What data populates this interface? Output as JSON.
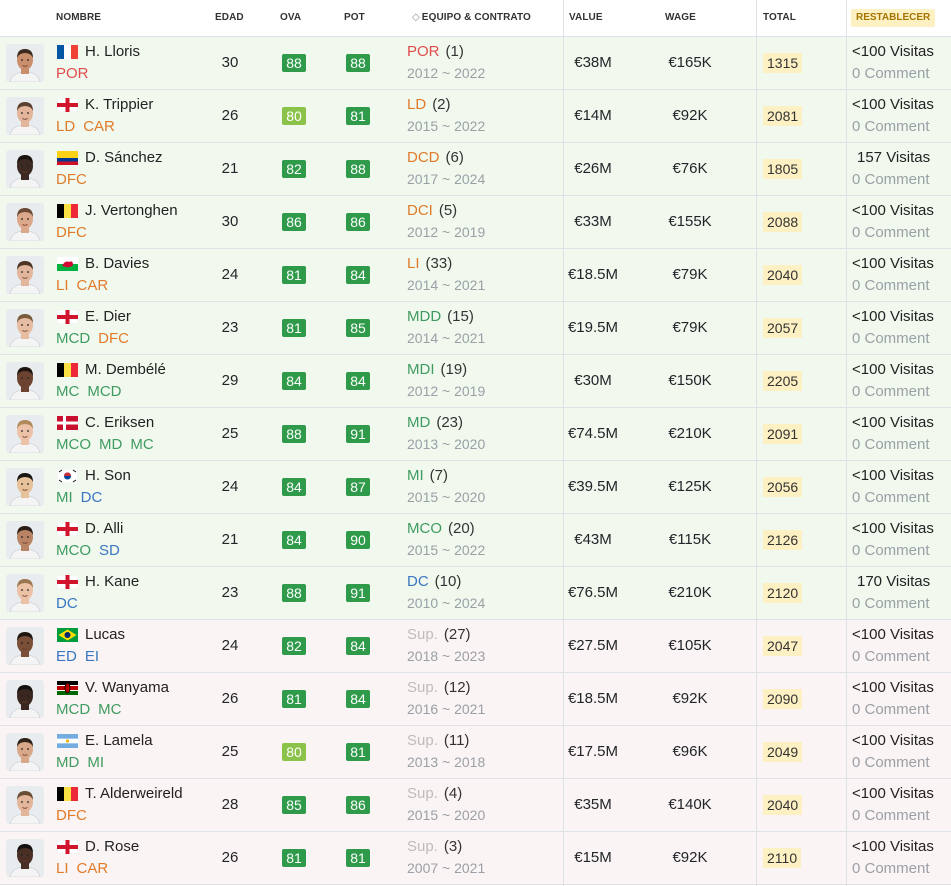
{
  "columns": {
    "name": "NOMBRE",
    "age": "EDAD",
    "ova": "OVA",
    "pot": "POT",
    "team": "EQUIPO & CONTRATO",
    "value": "VALUE",
    "wage": "WAGE",
    "total": "TOTAL",
    "reset": "RESTABLECER"
  },
  "colors": {
    "rating_high": "#2e9a4a",
    "rating_mid": "#8bc34a",
    "pos_forward": "#3a76c2",
    "pos_mid": "#3f9b5f",
    "pos_def": "#e07b2a",
    "pos_gk": "#e14c4c",
    "pos_sub": "#bdbdbd",
    "row_starting": "#f1f9ef",
    "row_sub": "#fbf4f4",
    "total_bg": "#fdf0c2"
  },
  "players": [
    {
      "name": "H. Lloris",
      "country": "France",
      "positions": [
        {
          "label": "POR",
          "kind": "gk"
        }
      ],
      "age": "30",
      "ova": "88",
      "ova_level": "high",
      "pot": "88",
      "pot_level": "high",
      "team_pos": "POR",
      "team_pos_kind": "gk",
      "number": "(1)",
      "contract": "2012 ~ 2022",
      "value": "€38M",
      "wage": "€165K",
      "total": "1315",
      "visits": "<100 Visitas",
      "comments": "0 Comment",
      "row": "starting",
      "skin": "#c98e6b",
      "hair": "#3a2a1f"
    },
    {
      "name": "K. Trippier",
      "country": "England",
      "positions": [
        {
          "label": "LD",
          "kind": "def"
        },
        {
          "label": "CAR",
          "kind": "def"
        }
      ],
      "age": "26",
      "ova": "80",
      "ova_level": "mid",
      "pot": "81",
      "pot_level": "high",
      "team_pos": "LD",
      "team_pos_kind": "def",
      "number": "(2)",
      "contract": "2015 ~ 2022",
      "value": "€14M",
      "wage": "€92K",
      "total": "2081",
      "visits": "<100 Visitas",
      "comments": "0 Comment",
      "row": "starting",
      "skin": "#e3b59a",
      "hair": "#5a4030"
    },
    {
      "name": "D. Sánchez",
      "country": "Colombia",
      "positions": [
        {
          "label": "DFC",
          "kind": "def"
        }
      ],
      "age": "21",
      "ova": "82",
      "ova_level": "high",
      "pot": "88",
      "pot_level": "high",
      "team_pos": "DCD",
      "team_pos_kind": "def",
      "number": "(6)",
      "contract": "2017 ~ 2024",
      "value": "€26M",
      "wage": "€76K",
      "total": "1805",
      "visits": "157 Visitas",
      "comments": "0 Comment",
      "row": "starting",
      "skin": "#3c2a22",
      "hair": "#1a1410"
    },
    {
      "name": "J. Vertonghen",
      "country": "Belgium",
      "positions": [
        {
          "label": "DFC",
          "kind": "def"
        }
      ],
      "age": "30",
      "ova": "86",
      "ova_level": "high",
      "pot": "86",
      "pot_level": "high",
      "team_pos": "DCI",
      "team_pos_kind": "def",
      "number": "(5)",
      "contract": "2012 ~ 2019",
      "value": "€33M",
      "wage": "€155K",
      "total": "2088",
      "visits": "<100 Visitas",
      "comments": "0 Comment",
      "row": "starting",
      "skin": "#dca88c",
      "hair": "#6b4a35"
    },
    {
      "name": "B. Davies",
      "country": "Wales",
      "positions": [
        {
          "label": "LI",
          "kind": "def"
        },
        {
          "label": "CAR",
          "kind": "def"
        }
      ],
      "age": "24",
      "ova": "81",
      "ova_level": "high",
      "pot": "84",
      "pot_level": "high",
      "team_pos": "LI",
      "team_pos_kind": "def",
      "number": "(33)",
      "contract": "2014 ~ 2021",
      "value": "€18.5M",
      "wage": "€79K",
      "total": "2040",
      "visits": "<100 Visitas",
      "comments": "0 Comment",
      "row": "starting",
      "skin": "#e2b69c",
      "hair": "#4d3626"
    },
    {
      "name": "E. Dier",
      "country": "England",
      "positions": [
        {
          "label": "MCD",
          "kind": "mid"
        },
        {
          "label": "DFC",
          "kind": "def"
        }
      ],
      "age": "23",
      "ova": "81",
      "ova_level": "high",
      "pot": "85",
      "pot_level": "high",
      "team_pos": "MDD",
      "team_pos_kind": "mid",
      "number": "(15)",
      "contract": "2014 ~ 2021",
      "value": "€19.5M",
      "wage": "€79K",
      "total": "2057",
      "visits": "<100 Visitas",
      "comments": "0 Comment",
      "row": "starting",
      "skin": "#e6bca2",
      "hair": "#7a5a3c"
    },
    {
      "name": "M. Dembélé",
      "country": "Belgium",
      "positions": [
        {
          "label": "MC",
          "kind": "mid"
        },
        {
          "label": "MCD",
          "kind": "mid"
        }
      ],
      "age": "29",
      "ova": "84",
      "ova_level": "high",
      "pot": "84",
      "pot_level": "high",
      "team_pos": "MDI",
      "team_pos_kind": "mid",
      "number": "(19)",
      "contract": "2012 ~ 2019",
      "value": "€30M",
      "wage": "€150K",
      "total": "2205",
      "visits": "<100 Visitas",
      "comments": "0 Comment",
      "row": "starting",
      "skin": "#6b4330",
      "hair": "#1e1510"
    },
    {
      "name": "C. Eriksen",
      "country": "Denmark",
      "positions": [
        {
          "label": "MCO",
          "kind": "mid"
        },
        {
          "label": "MD",
          "kind": "mid"
        },
        {
          "label": "MC",
          "kind": "mid"
        }
      ],
      "age": "25",
      "ova": "88",
      "ova_level": "high",
      "pot": "91",
      "pot_level": "high",
      "team_pos": "MD",
      "team_pos_kind": "mid",
      "number": "(23)",
      "contract": "2013 ~ 2020",
      "value": "€74.5M",
      "wage": "€210K",
      "total": "2091",
      "visits": "<100 Visitas",
      "comments": "0 Comment",
      "row": "starting",
      "skin": "#ecc3a8",
      "hair": "#b08a5a"
    },
    {
      "name": "H. Son",
      "country": "Korea",
      "positions": [
        {
          "label": "MI",
          "kind": "mid"
        },
        {
          "label": "DC",
          "kind": "fwd"
        }
      ],
      "age": "24",
      "ova": "84",
      "ova_level": "high",
      "pot": "87",
      "pot_level": "high",
      "team_pos": "MI",
      "team_pos_kind": "mid",
      "number": "(7)",
      "contract": "2015 ~ 2020",
      "value": "€39.5M",
      "wage": "€125K",
      "total": "2056",
      "visits": "<100 Visitas",
      "comments": "0 Comment",
      "row": "starting",
      "skin": "#e6c19a",
      "hair": "#1a1612"
    },
    {
      "name": "D. Alli",
      "country": "England",
      "positions": [
        {
          "label": "MCO",
          "kind": "mid"
        },
        {
          "label": "SD",
          "kind": "fwd"
        }
      ],
      "age": "21",
      "ova": "84",
      "ova_level": "high",
      "pot": "90",
      "pot_level": "high",
      "team_pos": "MCO",
      "team_pos_kind": "mid",
      "number": "(20)",
      "contract": "2015 ~ 2022",
      "value": "€43M",
      "wage": "€115K",
      "total": "2126",
      "visits": "<100 Visitas",
      "comments": "0 Comment",
      "row": "starting",
      "skin": "#b98466",
      "hair": "#2a1e16"
    },
    {
      "name": "H. Kane",
      "country": "England",
      "positions": [
        {
          "label": "DC",
          "kind": "fwd"
        }
      ],
      "age": "23",
      "ova": "88",
      "ova_level": "high",
      "pot": "91",
      "pot_level": "high",
      "team_pos": "DC",
      "team_pos_kind": "fwd",
      "number": "(10)",
      "contract": "2010 ~ 2024",
      "value": "€76.5M",
      "wage": "€210K",
      "total": "2120",
      "visits": "170 Visitas",
      "comments": "0 Comment",
      "row": "starting",
      "skin": "#ebc2a6",
      "hair": "#9c7650"
    },
    {
      "name": "Lucas",
      "country": "Brazil",
      "positions": [
        {
          "label": "ED",
          "kind": "fwd"
        },
        {
          "label": "EI",
          "kind": "fwd"
        }
      ],
      "age": "24",
      "ova": "82",
      "ova_level": "high",
      "pot": "84",
      "pot_level": "high",
      "team_pos": "Sup.",
      "team_pos_kind": "sub",
      "number": "(27)",
      "contract": "2018 ~ 2023",
      "value": "€27.5M",
      "wage": "€105K",
      "total": "2047",
      "visits": "<100 Visitas",
      "comments": "0 Comment",
      "row": "sub",
      "skin": "#7a4f38",
      "hair": "#1e1510"
    },
    {
      "name": "V. Wanyama",
      "country": "Kenya",
      "positions": [
        {
          "label": "MCD",
          "kind": "mid"
        },
        {
          "label": "MC",
          "kind": "mid"
        }
      ],
      "age": "26",
      "ova": "81",
      "ova_level": "high",
      "pot": "84",
      "pot_level": "high",
      "team_pos": "Sup.",
      "team_pos_kind": "sub",
      "number": "(12)",
      "contract": "2016 ~ 2021",
      "value": "€18.5M",
      "wage": "€92K",
      "total": "2090",
      "visits": "<100 Visitas",
      "comments": "0 Comment",
      "row": "sub",
      "skin": "#3a2820",
      "hair": "#141010"
    },
    {
      "name": "E. Lamela",
      "country": "Argentina",
      "positions": [
        {
          "label": "MD",
          "kind": "mid"
        },
        {
          "label": "MI",
          "kind": "mid"
        }
      ],
      "age": "25",
      "ova": "80",
      "ova_level": "mid",
      "pot": "81",
      "pot_level": "high",
      "team_pos": "Sup.",
      "team_pos_kind": "sub",
      "number": "(11)",
      "contract": "2013 ~ 2018",
      "value": "€17.5M",
      "wage": "€96K",
      "total": "2049",
      "visits": "<100 Visitas",
      "comments": "0 Comment",
      "row": "sub",
      "skin": "#d8a888",
      "hair": "#2e221a"
    },
    {
      "name": "T. Alderweireld",
      "country": "Belgium",
      "positions": [
        {
          "label": "DFC",
          "kind": "def"
        }
      ],
      "age": "28",
      "ova": "85",
      "ova_level": "high",
      "pot": "86",
      "pot_level": "high",
      "team_pos": "Sup.",
      "team_pos_kind": "sub",
      "number": "(4)",
      "contract": "2015 ~ 2020",
      "value": "€35M",
      "wage": "€140K",
      "total": "2040",
      "visits": "<100 Visitas",
      "comments": "0 Comment",
      "row": "sub",
      "skin": "#e3b59a",
      "hair": "#6a4c34"
    },
    {
      "name": "D. Rose",
      "country": "England",
      "positions": [
        {
          "label": "LI",
          "kind": "def"
        },
        {
          "label": "CAR",
          "kind": "def"
        }
      ],
      "age": "26",
      "ova": "81",
      "ova_level": "high",
      "pot": "81",
      "pot_level": "high",
      "team_pos": "Sup.",
      "team_pos_kind": "sub",
      "number": "(3)",
      "contract": "2007 ~ 2021",
      "value": "€15M",
      "wage": "€92K",
      "total": "2110",
      "visits": "<100 Visitas",
      "comments": "0 Comment",
      "row": "sub",
      "skin": "#4a3024",
      "hair": "#141010"
    }
  ]
}
